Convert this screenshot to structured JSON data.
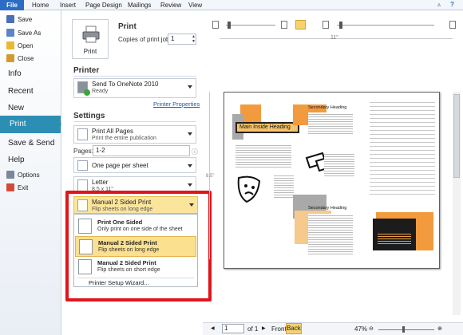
{
  "ribbon": {
    "file_tab": "File",
    "tabs": [
      "Home",
      "Insert",
      "Page Design",
      "Mailings",
      "Review",
      "View"
    ]
  },
  "nav": {
    "small_items": [
      "Save",
      "Save As",
      "Open",
      "Close"
    ],
    "big_items": [
      "Info",
      "Recent",
      "New"
    ],
    "selected": "Print",
    "lower_items": [
      "Save & Send",
      "Help"
    ],
    "bottom_items": [
      "Options",
      "Exit"
    ]
  },
  "print": {
    "title": "Print",
    "button_label": "Print",
    "copies_label": "Copies of print job:",
    "copies_value": "1"
  },
  "printer": {
    "heading": "Printer",
    "name": "Send To OneNote 2010",
    "status": "Ready",
    "properties_link": "Printer Properties"
  },
  "settings": {
    "heading": "Settings",
    "range_title": "Print All Pages",
    "range_desc": "Print the entire publication",
    "pages_label": "Pages:",
    "pages_value": "1-2",
    "layout_title": "One page per sheet",
    "paper_title": "Letter",
    "paper_desc": "8.5 x 11\"",
    "sides_title": "Manual 2 Sided Print",
    "sides_desc": "Flip sheets on long edge"
  },
  "dropdown": {
    "options": [
      {
        "title": "Print One Sided",
        "desc": "Only print on one side of the sheet"
      },
      {
        "title": "Manual 2 Sided Print",
        "desc": "Flip sheets on long edge"
      },
      {
        "title": "Manual 2 Sided Print",
        "desc": "Flip sheets on short edge"
      }
    ],
    "wizard_link": "Printer Setup Wizard...",
    "highlight_color": "#e0151b"
  },
  "preview": {
    "ruler_label": "11\"",
    "side_ruler_label": "8.5\"",
    "page_a": {
      "heading": "Main Inside Heading",
      "secondary_1": "Secondary Heading",
      "secondary_2": "Secondary Heading"
    }
  },
  "statusbar": {
    "page_value": "1",
    "of_label": "of 1",
    "front_label": "Front",
    "back_label": "Back",
    "zoom": "47%"
  },
  "colors": {
    "file_tab": "#2b6cc4",
    "nav_selected": "#2d8eb4",
    "accent_orange": "#f19a3e"
  }
}
